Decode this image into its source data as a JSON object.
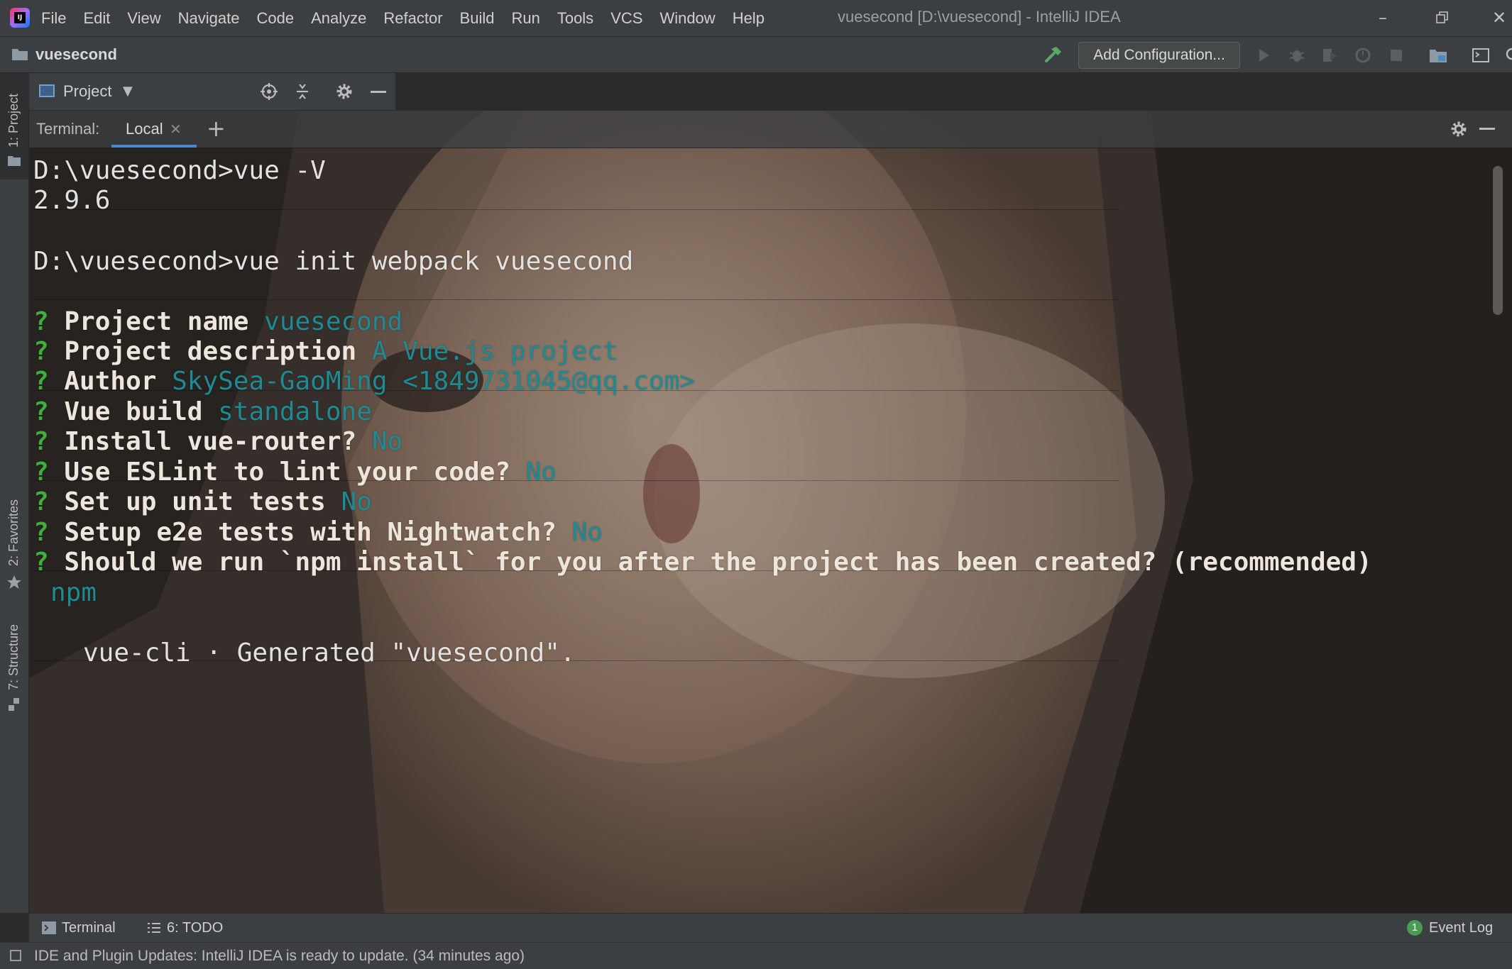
{
  "menu": {
    "items": [
      "File",
      "Edit",
      "View",
      "Navigate",
      "Code",
      "Analyze",
      "Refactor",
      "Build",
      "Run",
      "Tools",
      "VCS",
      "Window",
      "Help"
    ]
  },
  "window": {
    "title": "vuesecond [D:\\vuesecond] - IntelliJ IDEA",
    "logo_text": "IJ"
  },
  "navbar": {
    "project_name": "vuesecond",
    "add_configuration_label": "Add Configuration..."
  },
  "left_stripe": {
    "project_label": "1: Project",
    "favorites_label": "2: Favorites",
    "structure_label": "7: Structure"
  },
  "project_panel": {
    "title": "Project"
  },
  "terminal": {
    "label": "Terminal:",
    "tab_label": "Local",
    "lines": {
      "cmd1": "D:\\vuesecond>vue -V",
      "out1": "2.9.6",
      "cmd2": "D:\\vuesecond>vue init webpack vuesecond",
      "q1_text": "Project name ",
      "q1_answer": "vuesecond",
      "q2_text": "Project description ",
      "q2_answer": "A Vue.js project",
      "q3_text": "Author ",
      "q3_answer": "SkySea-GaoMing <1849731045@qq.com>",
      "q4_text": "Vue build ",
      "q4_answer": "standalone",
      "q5_text": "Install vue-router? ",
      "q5_answer": "No",
      "q6_text": "Use ESLint to lint your code? ",
      "q6_answer": "No",
      "q7_text": "Set up unit tests ",
      "q7_answer": "No",
      "q8_text": "Setup e2e tests with Nightwatch? ",
      "q8_answer": "No",
      "q9_text": "Should we run `npm install` for you after the project has been created? (recommended)",
      "q9_answer": "npm",
      "gen": "vue-cli · Generated \"vuesecond\"."
    },
    "prompt_marker": "?"
  },
  "bottom_bar": {
    "terminal_label": "Terminal",
    "todo_label": "6: TODO",
    "event_count": "1",
    "event_log_label": "Event Log"
  },
  "status_bar": {
    "message": "IDE and Plugin Updates: IntelliJ IDEA is ready to update. (34 minutes ago)"
  },
  "colors": {
    "chrome_bg": "#3c3f41",
    "editor_bg": "#2b2b2b",
    "prompt_green": "#3fae3f",
    "answer_teal": "#1e8a92",
    "tab_underline": "#4a88c7",
    "event_badge": "#499c54"
  }
}
